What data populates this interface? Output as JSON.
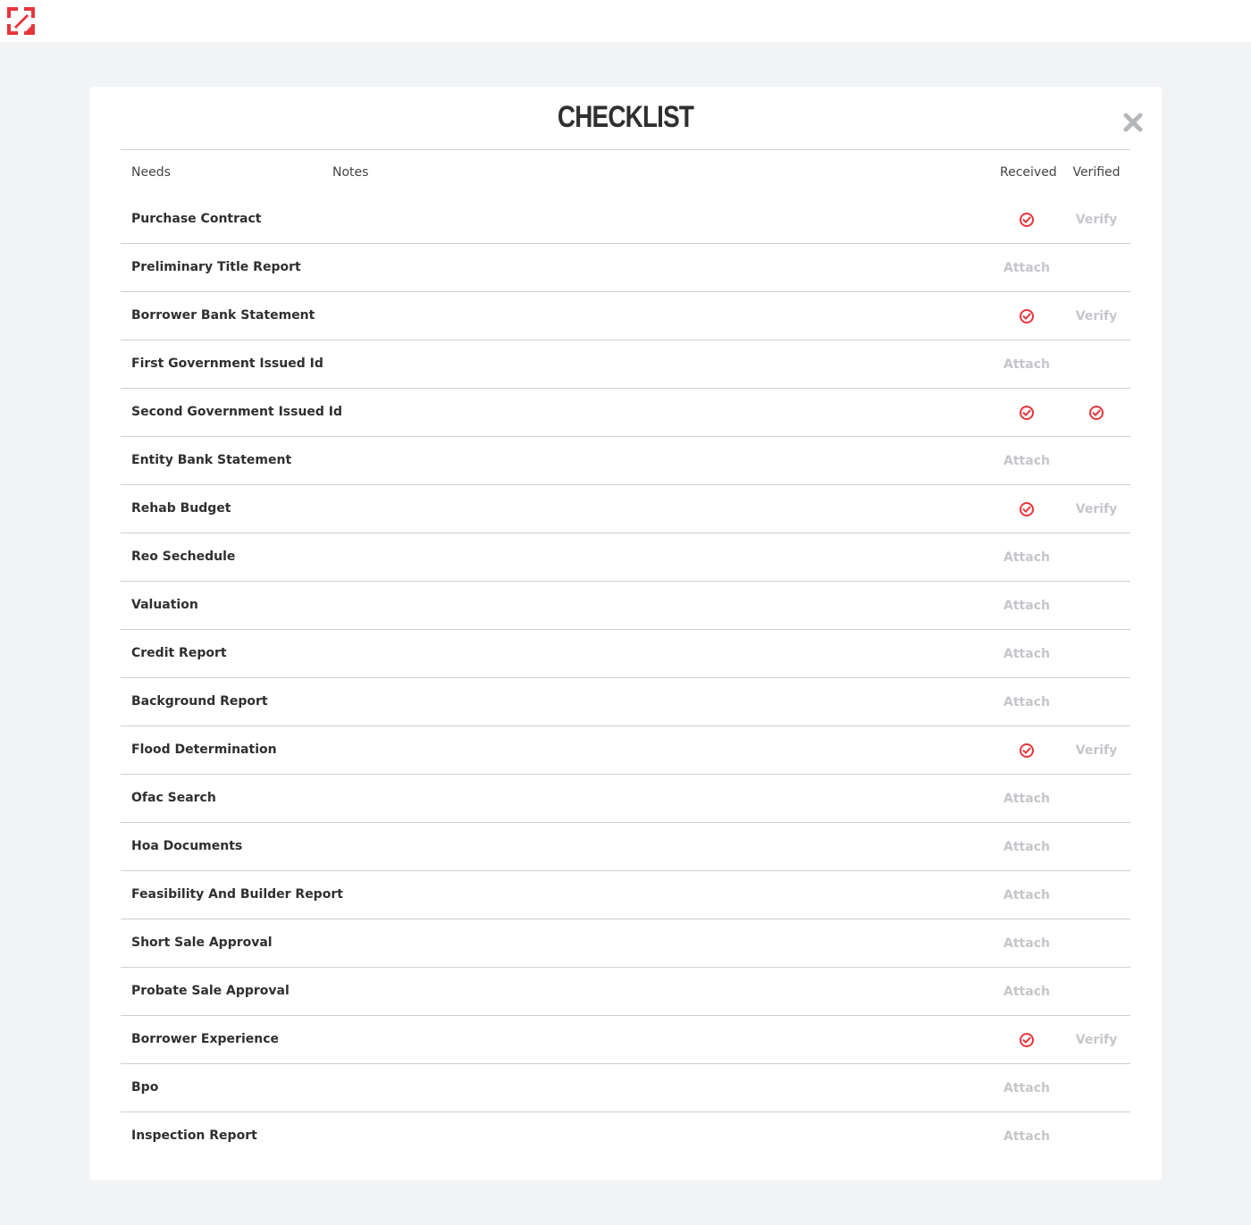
{
  "colors": {
    "accent": "#e8353b",
    "muted": "#c4c6ca",
    "text": "#2e2f31",
    "background": "#f2f3f5"
  },
  "header": {
    "logo_icon": "brand-logo-icon"
  },
  "modal": {
    "title": "CHECKLIST",
    "close_icon": "close-icon",
    "columns": {
      "needs": "Needs",
      "notes": "Notes",
      "received": "Received",
      "verified": "Verified"
    },
    "rows": [
      {
        "need": "Purchase Contract",
        "received": "check",
        "verified": "Verify"
      },
      {
        "need": "Preliminary Title Report",
        "received": "Attach",
        "verified": ""
      },
      {
        "need": "Borrower Bank Statement",
        "received": "check",
        "verified": "Verify"
      },
      {
        "need": "First Government Issued Id",
        "received": "Attach",
        "verified": ""
      },
      {
        "need": "Second Government Issued Id",
        "received": "check",
        "verified": "check"
      },
      {
        "need": "Entity Bank Statement",
        "received": "Attach",
        "verified": ""
      },
      {
        "need": "Rehab Budget",
        "received": "check",
        "verified": "Verify"
      },
      {
        "need": "Reo Sechedule",
        "received": "Attach",
        "verified": ""
      },
      {
        "need": "Valuation",
        "received": "Attach",
        "verified": ""
      },
      {
        "need": "Credit Report",
        "received": "Attach",
        "verified": ""
      },
      {
        "need": "Background Report",
        "received": "Attach",
        "verified": ""
      },
      {
        "need": "Flood Determination",
        "received": "check",
        "verified": "Verify"
      },
      {
        "need": "Ofac Search",
        "received": "Attach",
        "verified": ""
      },
      {
        "need": "Hoa Documents",
        "received": "Attach",
        "verified": ""
      },
      {
        "need": "Feasibility And Builder Report",
        "received": "Attach",
        "verified": ""
      },
      {
        "need": "Short Sale Approval",
        "received": "Attach",
        "verified": ""
      },
      {
        "need": "Probate Sale Approval",
        "received": "Attach",
        "verified": ""
      },
      {
        "need": "Borrower Experience",
        "received": "check",
        "verified": "Verify"
      },
      {
        "need": "Bpo",
        "received": "Attach",
        "verified": ""
      },
      {
        "need": "Inspection Report",
        "received": "Attach",
        "verified": ""
      }
    ]
  }
}
